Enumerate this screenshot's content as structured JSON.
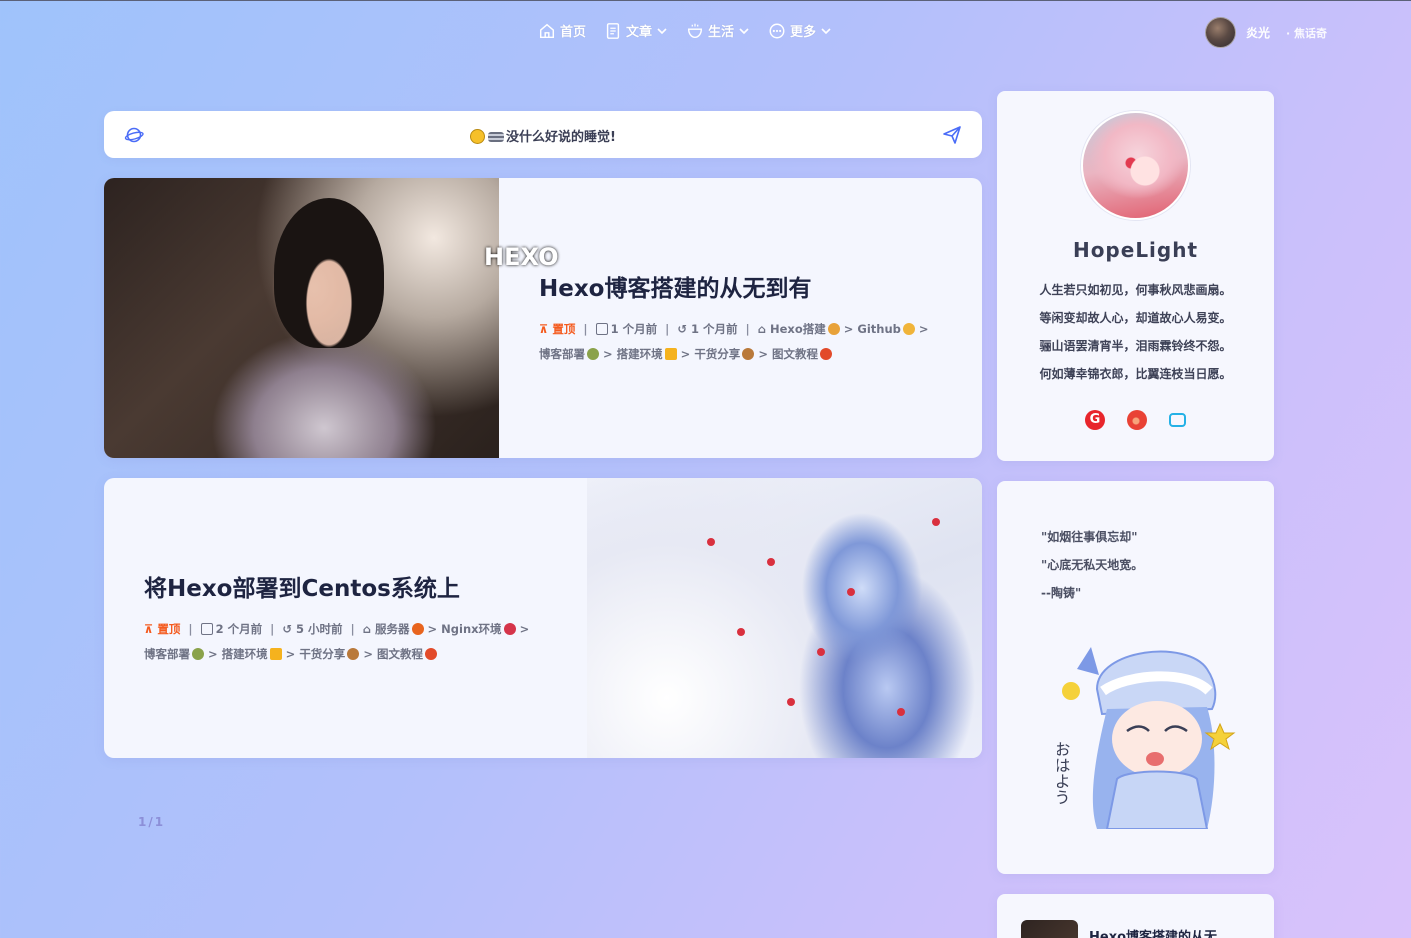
{
  "nav": {
    "items": [
      {
        "label": "首页",
        "icon": "home-icon",
        "dropdown": false
      },
      {
        "label": "文章",
        "icon": "article-icon",
        "dropdown": true
      },
      {
        "label": "生活",
        "icon": "life-icon",
        "dropdown": true
      },
      {
        "label": "更多",
        "icon": "more-icon",
        "dropdown": true
      }
    ],
    "user_name": "炎光",
    "user_sub": "· 焦话奇"
  },
  "say": {
    "text": "没什么好说的睡觉!"
  },
  "posts": [
    {
      "title": "Hexo博客搭建的从无到有",
      "pinned": "置顶",
      "created": "1 个月前",
      "updated": "1 个月前",
      "categories": [
        "Hexo搭建",
        "Github"
      ],
      "tags": [
        "博客部署",
        "搭建环境",
        "干货分享",
        "图文教程"
      ],
      "cover_text": "HEXO"
    },
    {
      "title": "将Hexo部署到Centos系统上",
      "pinned": "置顶",
      "created": "2 个月前",
      "updated": "5 小时前",
      "categories": [
        "服务器",
        "Nginx环境"
      ],
      "tags": [
        "博客部署",
        "搭建环境",
        "干货分享",
        "图文教程"
      ]
    }
  ],
  "pager": "1/1",
  "author": {
    "name": "HopeLight",
    "poem": [
      "人生若只如初见，何事秋风悲画扇。",
      "等闲变却故人心，却道故心人易变。",
      "骊山语罢清宵半，泪雨霖铃终不怨。",
      "何如薄幸锦衣郎，比翼连枝当日愿。"
    ],
    "socials": [
      "gitee-icon",
      "weibo-icon",
      "bilibili-icon"
    ]
  },
  "quote": {
    "lines": [
      "\"如烟往事俱忘却\"",
      "\"心底无私天地宽。",
      "--陶铸\""
    ],
    "sticker_text": "おはよう"
  },
  "recent": {
    "title": "Hexo博客搭建的从无"
  },
  "colors": {
    "accent": "#4a6cf7",
    "pin": "#f45a1e",
    "title": "#1e2441"
  }
}
